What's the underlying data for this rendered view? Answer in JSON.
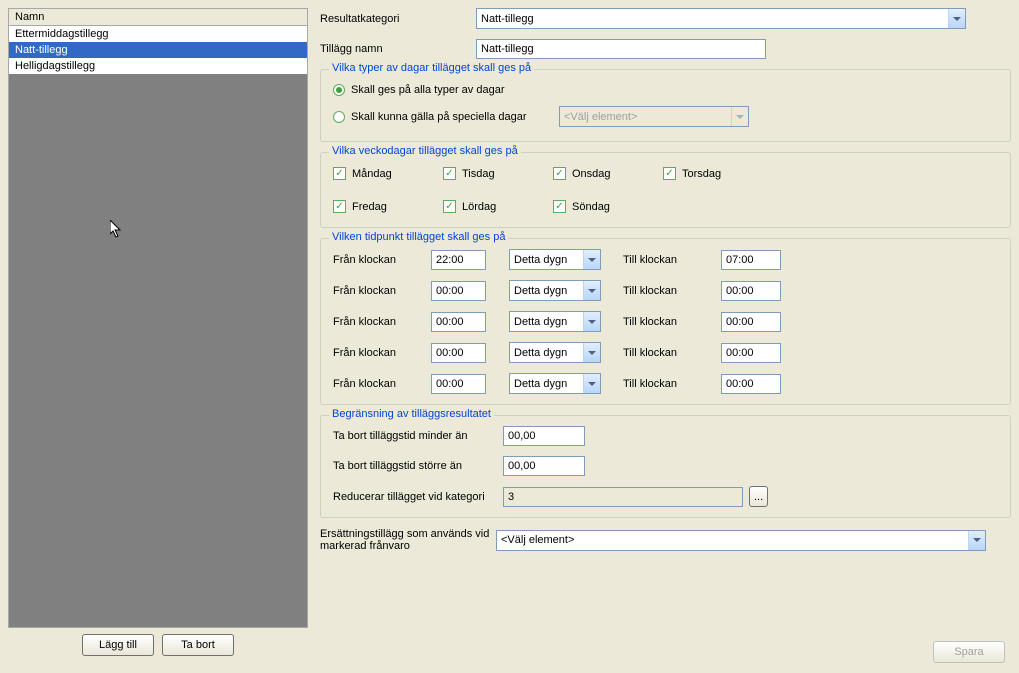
{
  "list": {
    "header": "Namn",
    "items": [
      "Ettermiddagstillegg",
      "Natt-tillegg",
      "Helligdagstillegg"
    ],
    "selectedIndex": 1
  },
  "buttons": {
    "add": "Lägg till",
    "remove": "Ta bort",
    "save": "Spara",
    "browse": "..."
  },
  "form": {
    "resultCategoryLabel": "Resultatkategori",
    "resultCategoryValue": "Natt-tillegg",
    "nameLabel": "Tillägg namn",
    "nameValue": "Natt-tillegg"
  },
  "dayTypes": {
    "legend": "Vilka typer av dagar tillägget skall ges på",
    "opt1": "Skall ges på alla typer av dagar",
    "opt2": "Skall kunna gälla på speciella dagar",
    "specialPlaceholder": "<Välj element>"
  },
  "weekdays": {
    "legend": "Vilka veckodagar tillägget skall ges på",
    "mon": "Måndag",
    "tue": "Tisdag",
    "wed": "Onsdag",
    "thu": "Torsdag",
    "fri": "Fredag",
    "sat": "Lördag",
    "sun": "Söndag"
  },
  "times": {
    "legend": "Vilken tidpunkt tillägget skall ges på",
    "fromLabel": "Från klockan",
    "toLabel": "Till klockan",
    "dayOption": "Detta dygn",
    "rows": [
      {
        "from": "22:00",
        "to": "07:00"
      },
      {
        "from": "00:00",
        "to": "00:00"
      },
      {
        "from": "00:00",
        "to": "00:00"
      },
      {
        "from": "00:00",
        "to": "00:00"
      },
      {
        "from": "00:00",
        "to": "00:00"
      }
    ]
  },
  "limits": {
    "legend": "Begränsning av tilläggsresultatet",
    "lessLabel": "Ta bort tilläggstid minder än",
    "lessValue": "00,00",
    "moreLabel": "Ta bort tilläggstid större än",
    "moreValue": "00,00",
    "reduceLabel": "Reducerar tillägget vid kategori",
    "reduceValue": "3"
  },
  "replacement": {
    "label": "Ersättningstillägg som används vid markerad frånvaro",
    "value": "<Välj element>"
  }
}
